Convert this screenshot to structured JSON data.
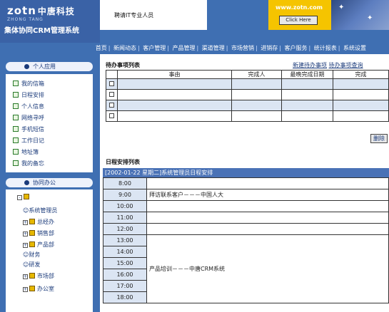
{
  "header": {
    "logo_text": "zotn",
    "logo_cn": "中唐科技",
    "logo_sub": "ZHONG TANG",
    "system_name": "集体协同CRM管理系统",
    "ad_text": "聘请IT专业人员",
    "ad_url": "www.zotn.com",
    "ad_button": "Click Here"
  },
  "nav": [
    "首页",
    "新闻动态",
    "客户管理",
    "产品管理",
    "渠道管理",
    "市场营销",
    "进销存",
    "客户服务",
    "统计报表",
    "系统设置"
  ],
  "left": {
    "personal_title": "个人应用",
    "personal_items": [
      "我的信箱",
      "日程安排",
      "个人信息",
      "网络寻呼",
      "手机短信",
      "工作日记",
      "地址簿",
      "我的备忘"
    ],
    "office_title": "协同办公",
    "tree_root": "",
    "tree_items": [
      "系统管理员",
      "总经办",
      "销售部",
      "产品部",
      "财务",
      "研发",
      "市场部",
      "办公室"
    ]
  },
  "todo": {
    "title": "待办事项列表",
    "links": [
      "新建待办事项",
      "待办事项查询"
    ],
    "columns": [
      "",
      "事由",
      "完成人",
      "最晚完成日期",
      "完成"
    ],
    "rows": [
      [
        "",
        "",
        "",
        ""
      ],
      [
        "",
        "",
        "",
        ""
      ],
      [
        "",
        "",
        "",
        ""
      ],
      [
        "",
        "",
        "",
        ""
      ]
    ],
    "delete_label": "删除"
  },
  "schedule": {
    "title": "日程安排列表",
    "header": "[2002-01-22 星期二]系统管理员日程安排",
    "rows": [
      {
        "time": "8:00",
        "event": ""
      },
      {
        "time": "9:00",
        "event": "拜访联系客户－－－中国人大"
      },
      {
        "time": "10:00",
        "event": ""
      },
      {
        "time": "11:00",
        "event": ""
      },
      {
        "time": "12:00",
        "event": ""
      }
    ],
    "block_times": [
      "13:00",
      "14:00",
      "15:00",
      "16:00",
      "17:00",
      "18:00"
    ],
    "block_event": "产品培训－－－中唐CRM系统"
  }
}
